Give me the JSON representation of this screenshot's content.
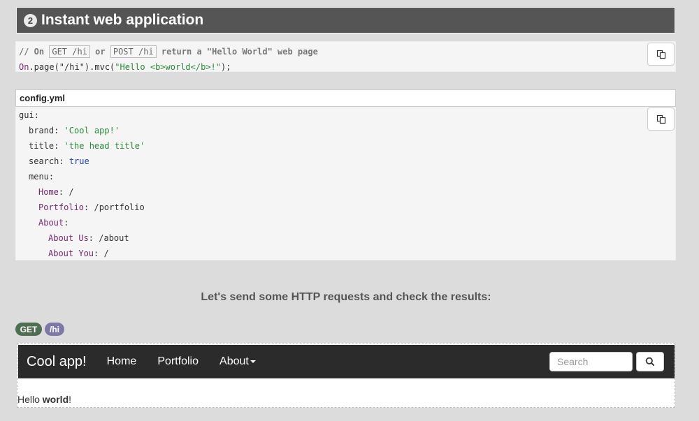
{
  "section": {
    "number": "2",
    "title": "Instant web application"
  },
  "code1": {
    "comment_prefix": "// On ",
    "get_kbd": "GET /hi",
    "or_text": " or ",
    "post_kbd": "POST /hi",
    "comment_suffix": " return a \"Hello World\" web page",
    "line2_fn": "On",
    "line2_a": ".page(\"/hi\").mvc(",
    "line2_str": "\"Hello <b>world</b>!\"",
    "line2_end": ");"
  },
  "config": {
    "filename": "config.yml",
    "lines": [
      {
        "key": "gui",
        "sep": ":",
        "value": "",
        "type": "",
        "indent": 0,
        "keyClass": "key"
      },
      {
        "key": "brand",
        "sep": ": ",
        "value": "'Cool app!'",
        "type": "str",
        "indent": 1,
        "keyClass": "key"
      },
      {
        "key": "title",
        "sep": ": ",
        "value": "'the head title'",
        "type": "str",
        "indent": 1,
        "keyClass": "key"
      },
      {
        "key": "search",
        "sep": ": ",
        "value": "true",
        "type": "bool",
        "indent": 1,
        "keyClass": "key"
      },
      {
        "key": "menu",
        "sep": ":",
        "value": "",
        "type": "",
        "indent": 1,
        "keyClass": "key"
      },
      {
        "key": "Home",
        "sep": ": ",
        "value": "/",
        "type": "plain",
        "indent": 2,
        "keyClass": "key2"
      },
      {
        "key": "Portfolio",
        "sep": ": ",
        "value": "/portfolio",
        "type": "plain",
        "indent": 2,
        "keyClass": "key2"
      },
      {
        "key": "About",
        "sep": ":",
        "value": "",
        "type": "",
        "indent": 2,
        "keyClass": "key2"
      },
      {
        "key": "About Us",
        "sep": ": ",
        "value": "/about",
        "type": "plain",
        "indent": 3,
        "keyClass": "key2"
      },
      {
        "key": "About You",
        "sep": ": ",
        "value": "/",
        "type": "plain",
        "indent": 3,
        "keyClass": "key2"
      }
    ]
  },
  "results_heading": "Let's send some HTTP requests and check the results:",
  "request": {
    "method": "GET",
    "path": "/hi"
  },
  "app": {
    "brand": "Cool app!",
    "nav": [
      "Home",
      "Portfolio",
      "About"
    ],
    "search_placeholder": "Search",
    "body_prefix": "Hello ",
    "body_bold": "world",
    "body_suffix": "!"
  },
  "colors": {
    "header_bg": "#555555",
    "get_pill": "#4e6e52",
    "path_pill": "#7e78a8",
    "navbar_bg": "#2b2b2b"
  },
  "icons": {
    "copy": "copy-icon",
    "search": "search-icon"
  }
}
